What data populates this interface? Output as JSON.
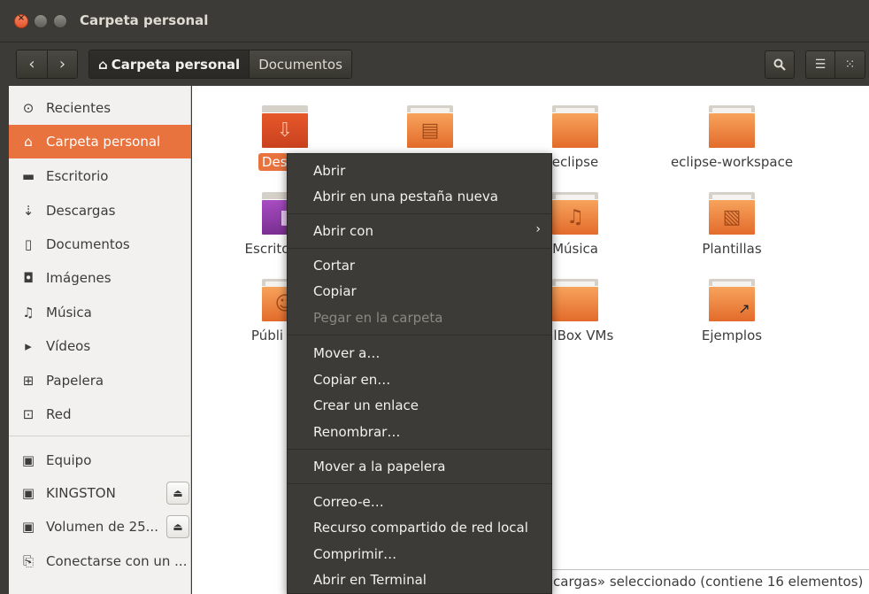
{
  "window": {
    "title": "Carpeta personal"
  },
  "toolbar": {
    "back_icon": "chevron-left-icon",
    "forward_icon": "chevron-right-icon",
    "breadcrumbs": [
      "Carpeta personal",
      "Documentos"
    ],
    "search_icon": "search-icon",
    "list_view_icon": "list-view-icon",
    "grid_view_icon": "grid-view-icon"
  },
  "sidebar": {
    "items": [
      {
        "label": "Recientes",
        "icon": "clock-icon",
        "glyph": "⊙"
      },
      {
        "label": "Carpeta personal",
        "icon": "home-icon",
        "glyph": "⌂",
        "active": true
      },
      {
        "label": "Escritorio",
        "icon": "folder-icon",
        "glyph": "▬"
      },
      {
        "label": "Descargas",
        "icon": "download-icon",
        "glyph": "⇣"
      },
      {
        "label": "Documentos",
        "icon": "document-icon",
        "glyph": "▯"
      },
      {
        "label": "Imágenes",
        "icon": "camera-icon",
        "glyph": "◘"
      },
      {
        "label": "Música",
        "icon": "music-icon",
        "glyph": "♫"
      },
      {
        "label": "Vídeos",
        "icon": "video-icon",
        "glyph": "▸"
      },
      {
        "label": "Papelera",
        "icon": "trash-icon",
        "glyph": "⊞"
      },
      {
        "label": "Red",
        "icon": "network-icon",
        "glyph": "⊡"
      }
    ],
    "devices": [
      {
        "label": "Equipo",
        "icon": "drive-icon",
        "glyph": "▣"
      },
      {
        "label": "KINGSTON",
        "icon": "drive-icon",
        "glyph": "▣",
        "eject": true
      },
      {
        "label": "Volumen de 25...",
        "icon": "drive-icon",
        "glyph": "▣",
        "eject": true
      },
      {
        "label": "Conectarse con un ...",
        "icon": "server-icon",
        "glyph": "⎘"
      }
    ]
  },
  "files": [
    {
      "label": "Descargas",
      "visible_label": "Descar",
      "selected": true
    },
    {
      "label": "",
      "type": "documents"
    },
    {
      "label": "eclipse"
    },
    {
      "label": "eclipse-workspace"
    },
    {
      "label": "Escrito"
    },
    {
      "label": "Música"
    },
    {
      "label": "Plantillas"
    },
    {
      "label": "Públi"
    },
    {
      "label": "ualBox VMs"
    },
    {
      "label": "Ejemplos"
    }
  ],
  "context_menu": {
    "items": [
      {
        "label": "Abrir"
      },
      {
        "label": "Abrir en una pestaña nueva"
      },
      {
        "label": "Abrir con",
        "submenu": true
      },
      {
        "label": "Cortar"
      },
      {
        "label": "Copiar"
      },
      {
        "label": "Pegar en la carpeta",
        "disabled": true
      },
      {
        "label": "Mover a…"
      },
      {
        "label": "Copiar en…"
      },
      {
        "label": "Crear un enlace"
      },
      {
        "label": "Renombrar…"
      },
      {
        "label": "Mover a la papelera"
      },
      {
        "label": "Correo-e…"
      },
      {
        "label": "Recurso compartido de red local"
      },
      {
        "label": "Comprimir…"
      },
      {
        "label": "Abrir en Terminal"
      }
    ]
  },
  "status": {
    "text": "cargas» seleccionado  (contiene 16 elementos)"
  },
  "colors": {
    "accent": "#e8733f",
    "chrome": "#3c3b37",
    "sidebar_bg": "#f2f1f0"
  }
}
